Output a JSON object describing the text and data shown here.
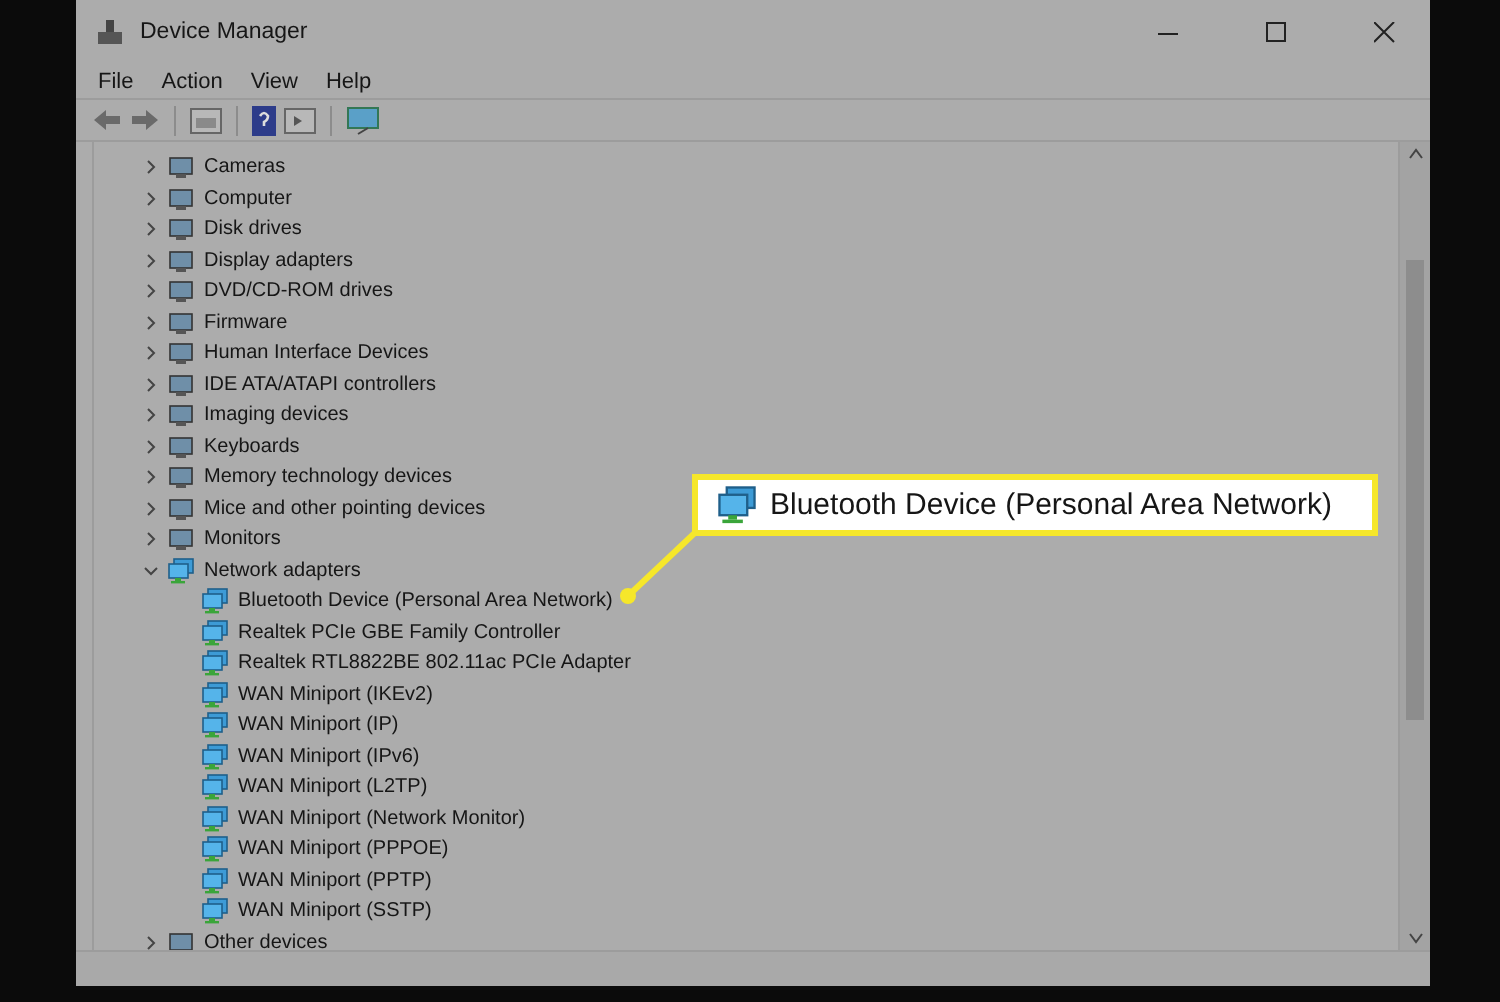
{
  "window": {
    "title": "Device Manager"
  },
  "menu": [
    "File",
    "Action",
    "View",
    "Help"
  ],
  "tree": [
    {
      "label": "Cameras",
      "expanded": false
    },
    {
      "label": "Computer",
      "expanded": false
    },
    {
      "label": "Disk drives",
      "expanded": false
    },
    {
      "label": "Display adapters",
      "expanded": false
    },
    {
      "label": "DVD/CD-ROM drives",
      "expanded": false
    },
    {
      "label": "Firmware",
      "expanded": false
    },
    {
      "label": "Human Interface Devices",
      "expanded": false
    },
    {
      "label": "IDE ATA/ATAPI controllers",
      "expanded": false
    },
    {
      "label": "Imaging devices",
      "expanded": false
    },
    {
      "label": "Keyboards",
      "expanded": false
    },
    {
      "label": "Memory technology devices",
      "expanded": false
    },
    {
      "label": "Mice and other pointing devices",
      "expanded": false
    },
    {
      "label": "Monitors",
      "expanded": false
    },
    {
      "label": "Network adapters",
      "expanded": true,
      "children": [
        {
          "label": "Bluetooth Device (Personal Area Network)"
        },
        {
          "label": "Realtek PCIe GBE Family Controller"
        },
        {
          "label": "Realtek RTL8822BE 802.11ac PCIe Adapter"
        },
        {
          "label": "WAN Miniport (IKEv2)"
        },
        {
          "label": "WAN Miniport (IP)"
        },
        {
          "label": "WAN Miniport (IPv6)"
        },
        {
          "label": "WAN Miniport (L2TP)"
        },
        {
          "label": "WAN Miniport (Network Monitor)"
        },
        {
          "label": "WAN Miniport (PPPOE)"
        },
        {
          "label": "WAN Miniport (PPTP)"
        },
        {
          "label": "WAN Miniport (SSTP)"
        }
      ]
    },
    {
      "label": "Other devices",
      "expanded": false
    }
  ],
  "callout": {
    "label": "Bluetooth Device (Personal Area Network)"
  }
}
